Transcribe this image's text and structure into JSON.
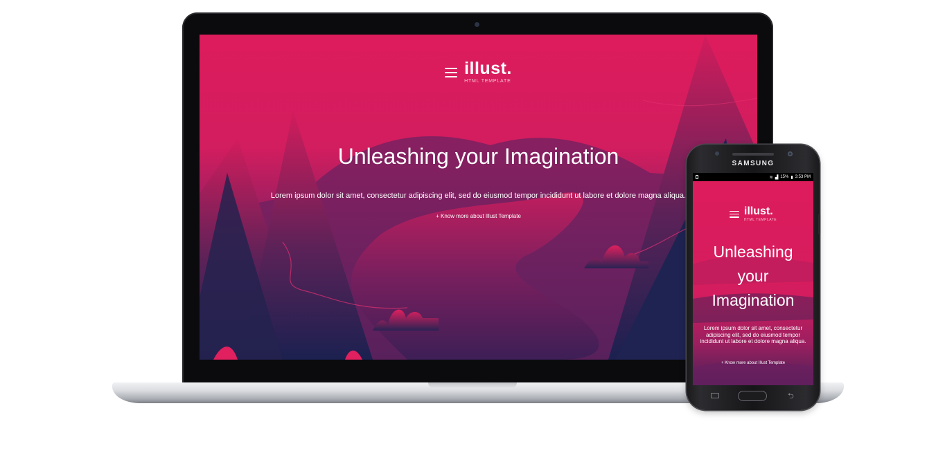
{
  "laptop": {
    "site": {
      "logo": "illust.",
      "logo_subtitle": "HTML TEMPLATE",
      "heading": "Unleashing your Imagination",
      "body": "Lorem ipsum dolor sit amet, consectetur adipiscing elit, sed do eiusmod tempor incididunt ut labore et dolore magna aliqua.",
      "cta_link": "+ Know more about Illust Template"
    }
  },
  "phone": {
    "brand": "SAMSUNG",
    "status_bar": {
      "battery": "15%",
      "time": "3:53 PM"
    },
    "site": {
      "logo": "illust.",
      "logo_subtitle": "HTML TEMPLATE",
      "heading": "Unleashing your Imagination",
      "body": "Lorem ipsum dolor sit amet, consectetur adipiscing elit, sed do eiusmod tempor incididunt ut labore et dolore magna aliqua.",
      "cta_link": "+ Know more about Illust Template"
    },
    "nav_icons": [
      "recent-apps-icon",
      "home-button",
      "back-icon"
    ]
  },
  "colors": {
    "hero_pink": "#d81c5a",
    "hero_navy": "#1b2150",
    "hero_mid": "#6a2158"
  }
}
